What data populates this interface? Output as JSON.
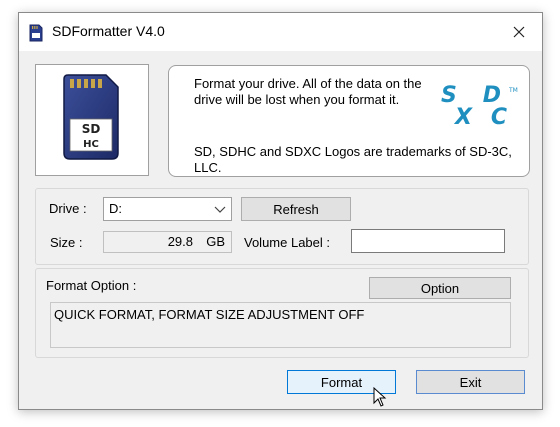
{
  "window": {
    "title": "SDFormatter V4.0"
  },
  "info": {
    "description": "Format your drive. All of the data on the drive will be lost when you format it.",
    "trademark": "SD, SDHC and SDXC Logos are trademarks of SD-3C, LLC.",
    "card_label": "SD HC",
    "logo_text": "SD XC"
  },
  "drive": {
    "drive_label": "Drive :",
    "drive_value": "D:",
    "refresh_label": "Refresh",
    "size_label": "Size :",
    "size_value": "29.8",
    "size_unit": "GB",
    "volume_label": "Volume Label :",
    "volume_value": ""
  },
  "format_option": {
    "title": "Format Option :",
    "option_button": "Option",
    "summary": "QUICK FORMAT, FORMAT SIZE ADJUSTMENT OFF"
  },
  "buttons": {
    "format": "Format",
    "exit": "Exit"
  }
}
